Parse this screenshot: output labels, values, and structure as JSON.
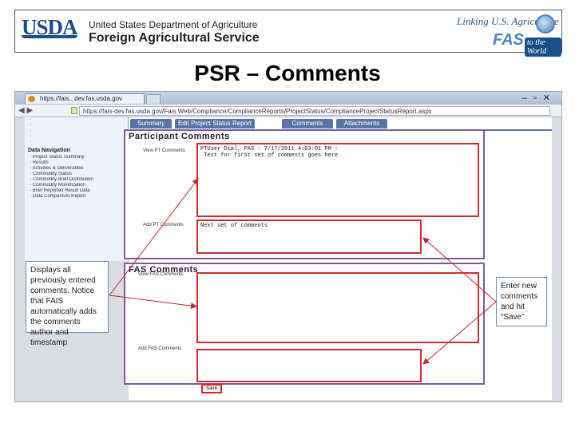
{
  "banner": {
    "logo_text": "USDA",
    "dept_line": "United States Department of Agriculture",
    "agency_line": "Foreign Agricultural Service",
    "tagline": "Linking U.S. Agriculture",
    "fas_mark": "FAS",
    "tagline_end": "to the World"
  },
  "slide_title": "PSR – Comments",
  "browser": {
    "tab_label": "https://fais...dev.fas.usda.gov",
    "url": "https://fais-dev.fas.usda.gov/Fais.Web/Compliance/ComplianceReports/ProjectStatus/ComplianceProjectStatusReport.aspx"
  },
  "left_nav": {
    "header": "Data Navigation",
    "items": [
      "Project Status Summary",
      "Results",
      "Activities & Deliverables",
      "Commodity Status",
      "Commodity Brief Distribution",
      "Commodity Monetization",
      "Brief Reported Result Data",
      "Data Comparison Report"
    ]
  },
  "tabs": [
    "Summary",
    "Edit Project Status Report",
    "Comments",
    "Attachments"
  ],
  "participant_section": {
    "title": "Participant Comments",
    "view_label": "View PT Comments",
    "view_text": "PTUser Dial, PA3 : 7/17/2011 4:03:01 PM :\n Test for first set of comments goes here",
    "add_label": "Add PT Comments",
    "add_text": "Next set of comments"
  },
  "fas_section": {
    "title": "FAS Comments",
    "view_label": "View FAS Comments",
    "add_label": "Add FAS Comments"
  },
  "save_label": "Save",
  "callouts": {
    "left": "Displays all previously entered comments. Notice that FAIS automatically adds the comments author and timestamp",
    "right": "Enter new comments and hit “Save”"
  },
  "colors": {
    "highlight": "#d42c2c",
    "section_border": "#7b5aa0",
    "tab_blue": "#5874a6",
    "usda_blue": "#1a4e8a"
  }
}
